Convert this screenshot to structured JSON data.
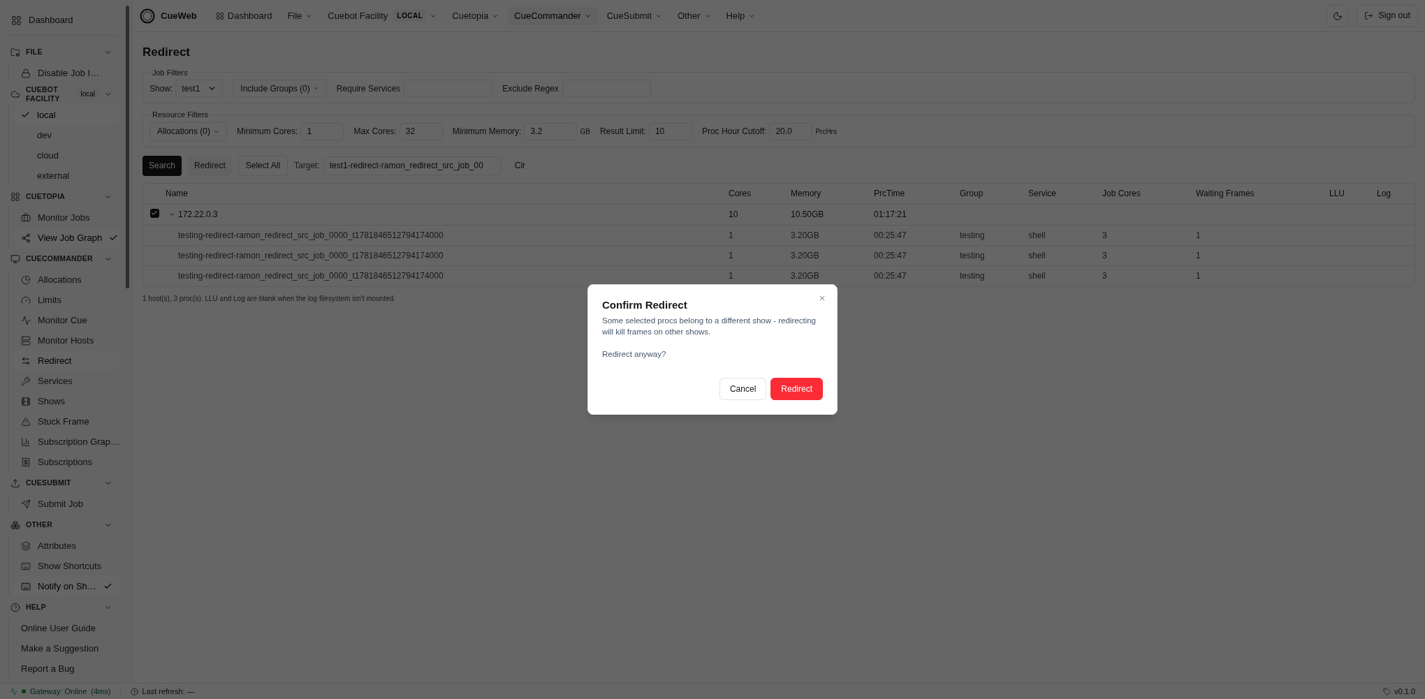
{
  "sidebar": {
    "dashboard": "Dashboard",
    "sections": [
      {
        "title": "FILE",
        "kind": "links",
        "expanded": true,
        "items": [
          {
            "label": "Disable Job I…",
            "selected": false,
            "checked": false
          }
        ]
      },
      {
        "title": "CUEBOT FACILITY",
        "badge": "local",
        "kind": "choices",
        "expanded": true,
        "items": [
          {
            "label": "local",
            "selected": true,
            "checked": true
          },
          {
            "label": "dev",
            "selected": false,
            "checked": false
          },
          {
            "label": "cloud",
            "selected": false,
            "checked": false
          },
          {
            "label": "external",
            "selected": false,
            "checked": false
          }
        ]
      },
      {
        "title": "CUETOPIA",
        "kind": "links",
        "expanded": true,
        "items": [
          {
            "label": "Monitor Jobs",
            "selected": false,
            "checked": false
          },
          {
            "label": "View Job Graph",
            "selected": true,
            "checked": true
          }
        ]
      },
      {
        "title": "CUECOMMANDER",
        "kind": "links",
        "expanded": true,
        "items": [
          {
            "label": "Allocations",
            "selected": false,
            "checked": false
          },
          {
            "label": "Limits",
            "selected": false,
            "checked": false
          },
          {
            "label": "Monitor Cue",
            "selected": false,
            "checked": false
          },
          {
            "label": "Monitor Hosts",
            "selected": false,
            "checked": false
          },
          {
            "label": "Redirect",
            "selected": true,
            "checked": false
          },
          {
            "label": "Services",
            "selected": false,
            "checked": false
          },
          {
            "label": "Shows",
            "selected": false,
            "checked": false
          },
          {
            "label": "Stuck Frame",
            "selected": false,
            "checked": false
          },
          {
            "label": "Subscription Grap…",
            "selected": false,
            "checked": false
          },
          {
            "label": "Subscriptions",
            "selected": false,
            "checked": false
          }
        ]
      },
      {
        "title": "CUESUBMIT",
        "kind": "links",
        "expanded": true,
        "items": [
          {
            "label": "Submit Job",
            "selected": false,
            "checked": false
          }
        ]
      },
      {
        "title": "OTHER",
        "kind": "links",
        "expanded": true,
        "items": [
          {
            "label": "Attributes",
            "selected": false,
            "checked": false
          },
          {
            "label": "Show Shortcuts",
            "selected": false,
            "checked": false
          },
          {
            "label": "Notify on Sh…",
            "selected": true,
            "checked": true
          }
        ]
      },
      {
        "title": "HELP",
        "kind": "links",
        "expanded": true,
        "items": [
          {
            "label": "Online User Guide",
            "selected": false,
            "checked": false
          },
          {
            "label": "Make a Suggestion",
            "selected": false,
            "checked": false
          },
          {
            "label": "Report a Bug",
            "selected": false,
            "checked": false
          }
        ]
      }
    ]
  },
  "navbar": {
    "brand": "CueWeb",
    "items": [
      {
        "label": "Dashboard",
        "kind": "link",
        "selected": false
      },
      {
        "label": "File",
        "kind": "menu",
        "selected": false
      },
      {
        "label": "Cuebot Facility",
        "kind": "menu",
        "badge": "LOCAL",
        "selected": false
      },
      {
        "label": "Cuetopia",
        "kind": "menu",
        "selected": false
      },
      {
        "label": "CueCommander",
        "kind": "menu",
        "selected": true
      },
      {
        "label": "CueSubmit",
        "kind": "menu",
        "selected": false
      },
      {
        "label": "Other",
        "kind": "menu",
        "selected": false
      },
      {
        "label": "Help",
        "kind": "menu",
        "selected": false
      }
    ],
    "sign_out": "Sign out"
  },
  "page": {
    "title": "Redirect",
    "job_filters": {
      "legend": "Job Filters",
      "show_label": "Show:",
      "show_value": "test1",
      "include_groups": "Include Groups (0)",
      "require_services_label": "Require Services",
      "exclude_regex_label": "Exclude Regex"
    },
    "resource_filters": {
      "legend": "Resource Filters",
      "allocations": "Allocations (0)",
      "fields": [
        {
          "label": "Minimum Cores:",
          "value": "1"
        },
        {
          "label": "Max Cores:",
          "value": "32"
        },
        {
          "label": "Minimum Memory:",
          "value": "3.2",
          "unit": "GB"
        },
        {
          "label": "Result Limit:",
          "value": "10"
        },
        {
          "label": "Proc Hour Cutoff:",
          "value": "20.0",
          "unit": "PrcHrs"
        }
      ]
    },
    "actions": {
      "search": "Search",
      "redirect": "Redirect",
      "select_all": "Select All",
      "target_label": "Target:",
      "target_value": "test1-redirect-ramon_redirect_src_job_00",
      "clear": "Clr"
    },
    "table": {
      "columns": [
        "Name",
        "Cores",
        "Memory",
        "PrcTime",
        "Group",
        "Service",
        "Job Cores",
        "Waiting Frames",
        "LLU",
        "Log"
      ],
      "rows": [
        {
          "checked": true,
          "expanded": true,
          "cells": [
            "172.22.0.3",
            "10",
            "10.50GB",
            "01:17:21"
          ],
          "children": [
            {
              "cells": [
                "testing-redirect-ramon_redirect_src_job_0000_t1781846512794174000",
                "1",
                "3.20GB",
                "00:25:47",
                "testing",
                "shell",
                "3",
                "1"
              ]
            },
            {
              "cells": [
                "testing-redirect-ramon_redirect_src_job_0000_t1781846512794174000",
                "1",
                "3.20GB",
                "00:25:47",
                "testing",
                "shell",
                "3",
                "1"
              ]
            },
            {
              "cells": [
                "testing-redirect-ramon_redirect_src_job_0000_t1781846512794174000",
                "1",
                "3.20GB",
                "00:25:47",
                "testing",
                "shell",
                "3",
                "1"
              ]
            }
          ]
        }
      ]
    },
    "footnote": "1 host(s), 3 proc(s). LLU and Log are blank when the log filesystem isn't mounted."
  },
  "status_bar": {
    "gateway": "Gateway: Online",
    "online": true,
    "latency": "(4ms)",
    "last_refresh": "Last refresh: —",
    "version": "v0.1.0"
  },
  "dialog": {
    "title": "Confirm Redirect",
    "message": "Some selected procs belong to a different show - redirecting will kill frames on other shows.",
    "question": "Redirect anyway?",
    "buttons": [
      {
        "label": "Cancel",
        "kind": "secondary"
      },
      {
        "label": "Redirect",
        "kind": "danger"
      }
    ]
  }
}
